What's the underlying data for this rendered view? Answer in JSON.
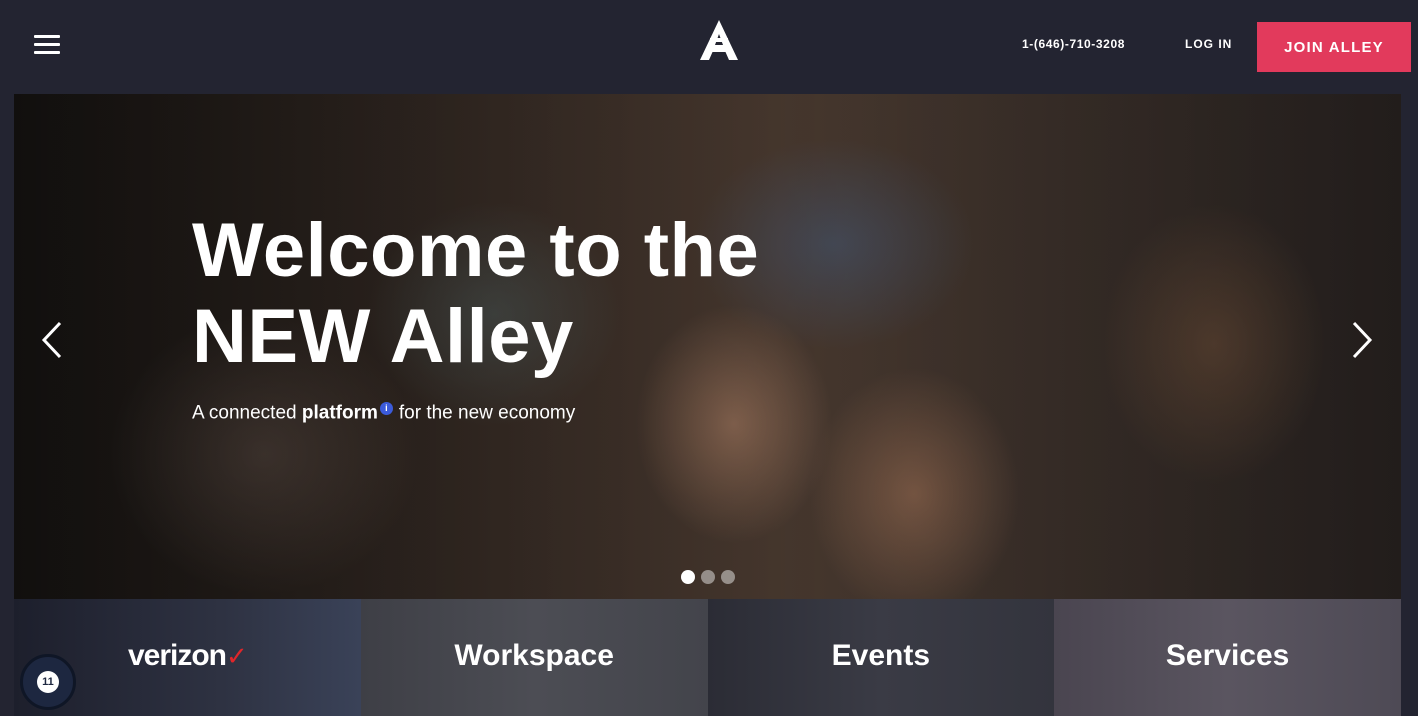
{
  "header": {
    "logo_name": "alley-logo",
    "phone": "1-(646)-710-3208",
    "login_label": "LOG IN",
    "join_label": "JOIN ALLEY",
    "join_color": "#e23a5c"
  },
  "hero": {
    "headline_line1": "Welcome to the",
    "headline_line2": "NEW Alley",
    "subline_prefix": "A connected ",
    "subline_bold": "platform",
    "info_marker": "i",
    "subline_suffix": "for the new economy",
    "slide_count": 3,
    "active_slide": 1
  },
  "tiles": [
    {
      "label": "verizon",
      "check": "✓"
    },
    {
      "label": "Workspace"
    },
    {
      "label": "Events"
    },
    {
      "label": "Services"
    }
  ],
  "notification_badge": {
    "count": "11"
  }
}
